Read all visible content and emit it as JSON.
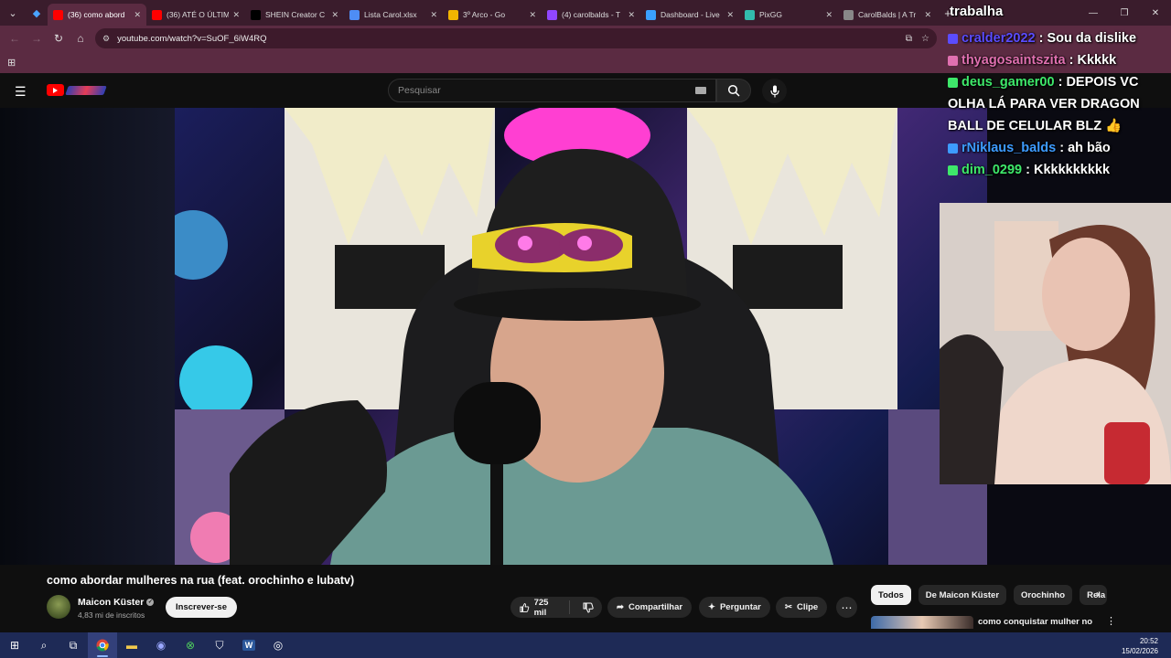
{
  "browser": {
    "tabs": [
      {
        "label": "(36) como abord",
        "icon": "youtube-icon",
        "color": "#ff0000",
        "active": true
      },
      {
        "label": "(36) ATÉ O ÚLTIM",
        "icon": "youtube-icon",
        "color": "#ff0000",
        "active": false
      },
      {
        "label": "SHEIN Creator C",
        "icon": "shein-icon",
        "color": "#000000",
        "active": false
      },
      {
        "label": "Lista Carol.xlsx",
        "icon": "sheets-icon",
        "color": "#4e8df5",
        "active": false
      },
      {
        "label": "3º Arco - Go",
        "icon": "drive-icon",
        "color": "#f2b400",
        "active": false
      },
      {
        "label": "(4) carolbalds - T",
        "icon": "twitch-icon",
        "color": "#9146ff",
        "active": false
      },
      {
        "label": "Dashboard - Live",
        "icon": "dashboard-icon",
        "color": "#3aa0ff",
        "active": false
      },
      {
        "label": "PixGG",
        "icon": "pix-icon",
        "color": "#32bcad",
        "active": false
      },
      {
        "label": "CarolBalds | A Tr",
        "icon": "globe-icon",
        "color": "#888888",
        "active": false
      }
    ],
    "url": "youtube.com/watch?v=SuOF_6iW4RQ"
  },
  "youtube": {
    "search_placeholder": "Pesquisar",
    "video_title": "como abordar mulheres na rua (feat. orochinho e lubatv)",
    "channel_name": "Maicon Küster",
    "subscribers": "4,83 mi de inscritos",
    "subscribe_label": "Inscrever-se",
    "likes": "725 mil",
    "share_label": "Compartilhar",
    "ask_label": "Perguntar",
    "clip_label": "Clipe",
    "chips": [
      "Todos",
      "De Maicon Küster",
      "Orochinho",
      "Rela"
    ],
    "rec_title": "como conquistar mulher no whatsapp (feat. orochinho)"
  },
  "overlay": {
    "word": "trabalha",
    "chat": [
      {
        "user": "cralder2022",
        "text": "Sou da dislike",
        "color": "#5b4cff"
      },
      {
        "user": "thyagosaintszita",
        "text": "Kkkkk",
        "color": "#e070b0"
      },
      {
        "user": "deus_gamer00",
        "text": "DEPOIS VC OLHA LÁ PARA VER DRAGON BALL DE CELULAR BLZ 👍",
        "color": "#3ee86a"
      },
      {
        "user": "rNiklaus_balds",
        "text": "ah bão",
        "color": "#3d9bff"
      },
      {
        "user": "dim_0299",
        "text": "Kkkkkkkkkk",
        "color": "#3ee86a"
      }
    ]
  },
  "taskbar": {
    "time": "20:52",
    "date": "15/02/2026"
  }
}
